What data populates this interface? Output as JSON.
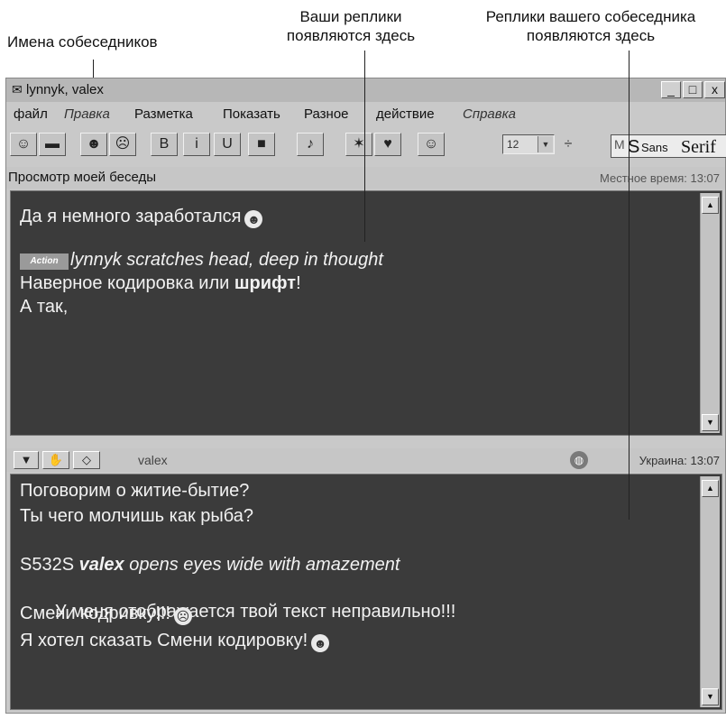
{
  "annotations": {
    "names": "Имена собеседников",
    "yours_line1": "Ваши реплики",
    "yours_line2": "появляются здесь",
    "theirs_line1": "Реплики вашего собеседника",
    "theirs_line2": "появляются здесь"
  },
  "window": {
    "title": "lynnyk, valex",
    "title_icon": "chat-bubble-icon",
    "controls": {
      "minimize": "_",
      "maximize": "□",
      "close": "x"
    }
  },
  "menu": [
    "файл",
    "Правка",
    "Разметка",
    "Показать",
    "Разное",
    "действие",
    "Справка"
  ],
  "toolbar": {
    "buttons": [
      {
        "icon": "chat-icon",
        "glyph": "☺"
      },
      {
        "icon": "print-icon",
        "glyph": "▬"
      },
      {
        "icon": "smiley-icon",
        "glyph": "☻"
      },
      {
        "icon": "face-icon",
        "glyph": "☹"
      },
      {
        "icon": "bold-icon",
        "glyph": "B"
      },
      {
        "icon": "italic-icon",
        "glyph": "i"
      },
      {
        "icon": "underline-icon",
        "glyph": "U"
      },
      {
        "icon": "color-icon",
        "glyph": "■"
      },
      {
        "icon": "action-icon",
        "glyph": "♪"
      },
      {
        "icon": "running-man-icon",
        "glyph": "✶"
      },
      {
        "icon": "heart-icon",
        "glyph": "♥"
      },
      {
        "icon": "emoticon-icon",
        "glyph": "☺"
      }
    ],
    "font_size": "12",
    "font_prefix": "M",
    "font_s": "S",
    "font_sans": "Sans",
    "font_serif": "Serif"
  },
  "history": {
    "label": "Просмотр моей беседы",
    "time": "Местное время: 13:07",
    "messages": [
      {
        "text": "Да я немного заработался",
        "emoji": "☻"
      },
      {
        "badge": "Action",
        "text": "lynnyk scratches head, deep in thought"
      },
      {
        "text_before": "Наверное кодировка или ",
        "bold": "шрифт",
        "text_after": "!"
      },
      {
        "text": "А так,"
      }
    ]
  },
  "input": {
    "name": "valex",
    "location": "Украина: 13:07",
    "messages": [
      {
        "text": "Поговорим о житие-бытие?"
      },
      {
        "text": "Ты чего молчишь как рыба?"
      },
      {
        "prefix": "S532S",
        "name": "valex",
        "text": "opens eyes wide with amazement"
      },
      {
        "text": " У меня отображается твой текст неправильно!!!"
      },
      {
        "text": "Смени кодривку!!!",
        "emoji": "☹"
      },
      {
        "text": "Я хотел сказать Смени кодировку!",
        "emoji": "☻"
      }
    ]
  }
}
